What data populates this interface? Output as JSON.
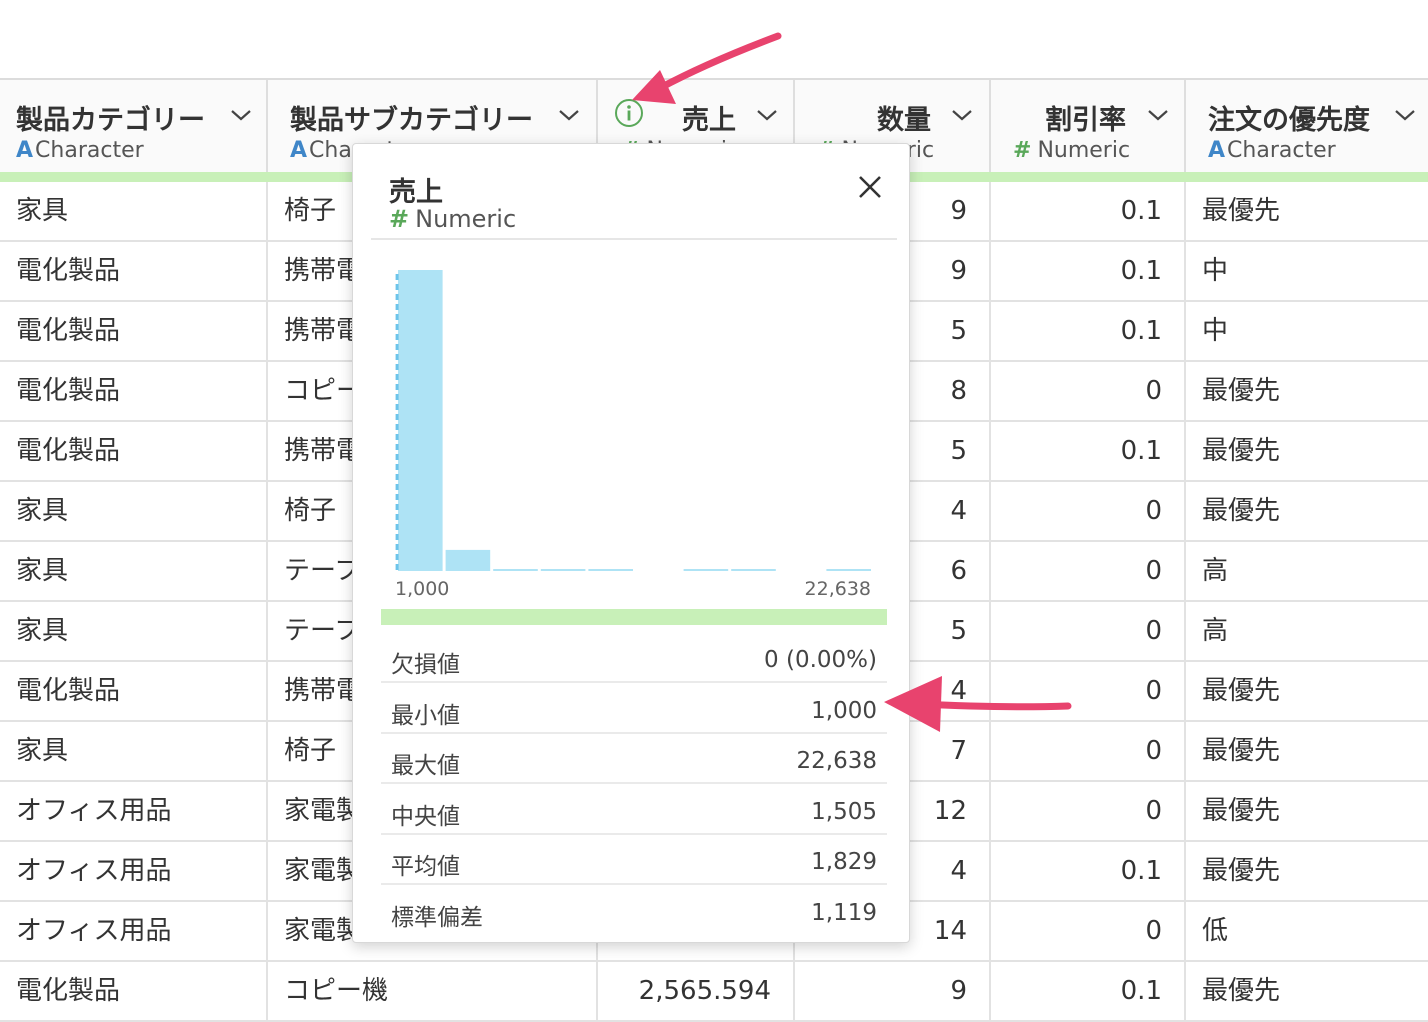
{
  "columns": [
    {
      "name": "製品カテゴリー",
      "type_symbol": "A",
      "type_label": "Character"
    },
    {
      "name": "製品サブカテゴリー",
      "type_symbol": "A",
      "type_label": "Character"
    },
    {
      "name": "売上",
      "type_symbol": "#",
      "type_label": "Numeric"
    },
    {
      "name": "数量",
      "type_symbol": "#",
      "type_label": "Numeric"
    },
    {
      "name": "割引率",
      "type_symbol": "#",
      "type_label": "Numeric"
    },
    {
      "name": "注文の優先度",
      "type_symbol": "A",
      "type_label": "Character"
    }
  ],
  "rows": [
    [
      "家具",
      "椅子",
      "",
      "9",
      "0.1",
      "最優先"
    ],
    [
      "電化製品",
      "携帯電話",
      "",
      "9",
      "0.1",
      "中"
    ],
    [
      "電化製品",
      "携帯電話",
      "",
      "5",
      "0.1",
      "中"
    ],
    [
      "電化製品",
      "コピー機",
      "",
      "8",
      "0",
      "最優先"
    ],
    [
      "電化製品",
      "携帯電話",
      "",
      "5",
      "0.1",
      "最優先"
    ],
    [
      "家具",
      "椅子",
      "",
      "4",
      "0",
      "最優先"
    ],
    [
      "家具",
      "テーブル",
      "",
      "6",
      "0",
      "高"
    ],
    [
      "家具",
      "テーブル",
      "",
      "5",
      "0",
      "高"
    ],
    [
      "電化製品",
      "携帯電話",
      "",
      "4",
      "0",
      "最優先"
    ],
    [
      "家具",
      "椅子",
      "",
      "7",
      "0",
      "最優先"
    ],
    [
      "オフィス用品",
      "家電製品",
      "",
      "12",
      "0",
      "最優先"
    ],
    [
      "オフィス用品",
      "家電製品",
      "",
      "4",
      "0.1",
      "最優先"
    ],
    [
      "オフィス用品",
      "家電製品",
      "",
      "14",
      "0",
      "低"
    ],
    [
      "電化製品",
      "コピー機",
      "2,565.594",
      "9",
      "0.1",
      "最優先"
    ]
  ],
  "popup": {
    "title": "売上",
    "type_symbol": "#",
    "type_label": "Numeric",
    "stats": [
      {
        "label": "欠損値",
        "value": "0 (0.00%)"
      },
      {
        "label": "最小値",
        "value": "1,000"
      },
      {
        "label": "最大値",
        "value": "22,638"
      },
      {
        "label": "中央値",
        "value": "1,505"
      },
      {
        "label": "平均値",
        "value": "1,829"
      },
      {
        "label": "標準偏差",
        "value": "1,119"
      }
    ]
  },
  "chart_data": {
    "type": "bar",
    "title": "",
    "x_range_labels": [
      "1,000",
      "22,638"
    ],
    "xlim": [
      1000,
      22638
    ],
    "values": [
      100,
      7,
      0.4,
      0.3,
      0.3,
      0,
      0.3,
      0.3,
      0,
      0.3
    ],
    "ylim": [
      0,
      100
    ],
    "median": 1505,
    "color": "#aee3f5"
  },
  "colors": {
    "accent_arrow": "#e8436e",
    "quality_bar": "#c8f0b8",
    "character_type": "#3f86c8",
    "numeric_type": "#5aa85a",
    "info_icon": "#5aa85a"
  }
}
